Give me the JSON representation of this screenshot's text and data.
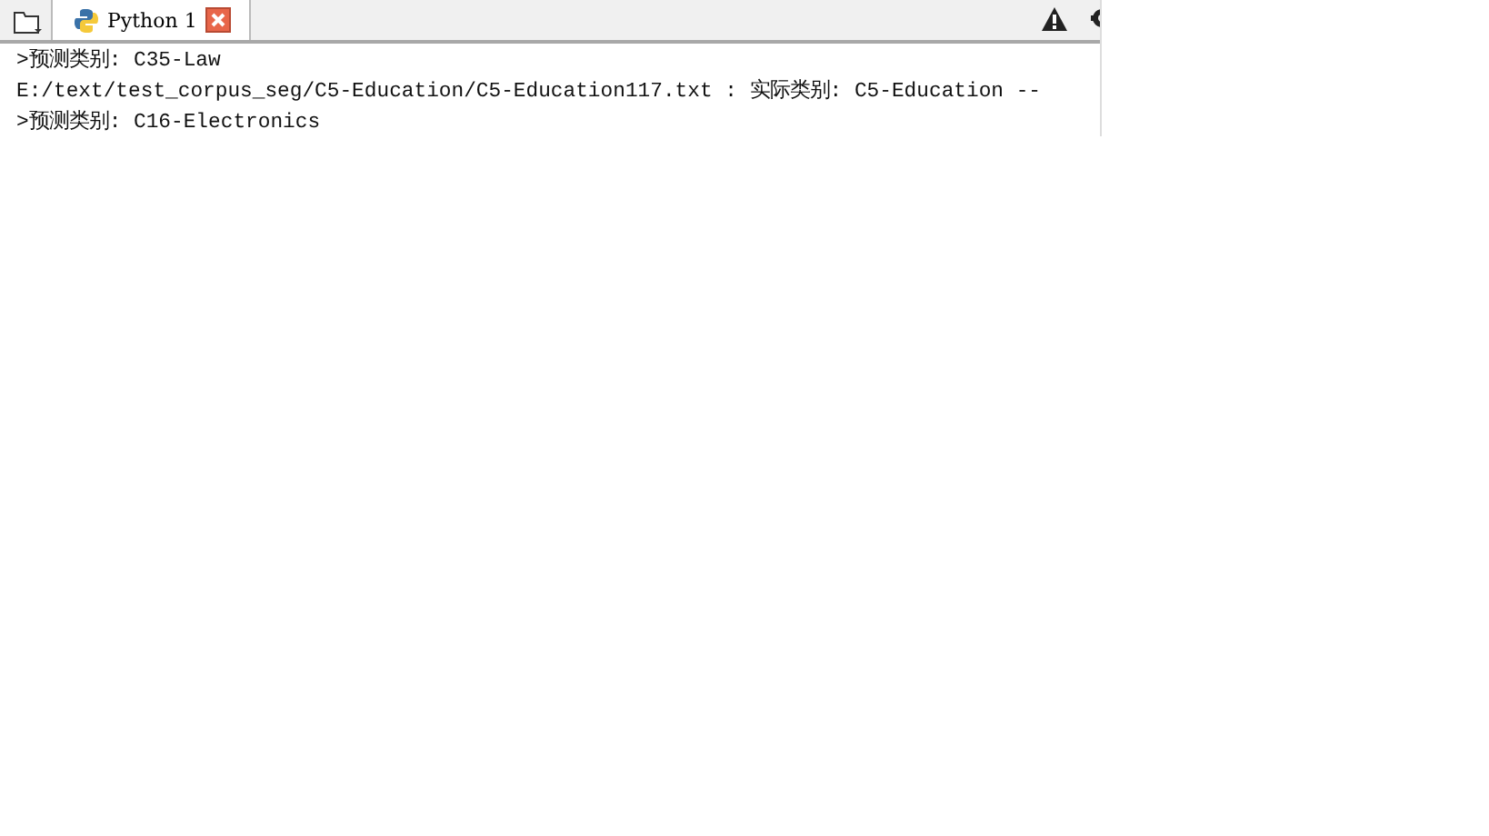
{
  "tabs": [
    {
      "label": "Python 1",
      "selected": true
    }
  ],
  "console": {
    "lines": [
      ">预测类别: C35-Law",
      "E:/text/test_corpus_seg/C5-Education/C5-Education117.txt : 实际类别: C5-Education  --",
      ">预测类别: C16-Electronics"
    ]
  }
}
